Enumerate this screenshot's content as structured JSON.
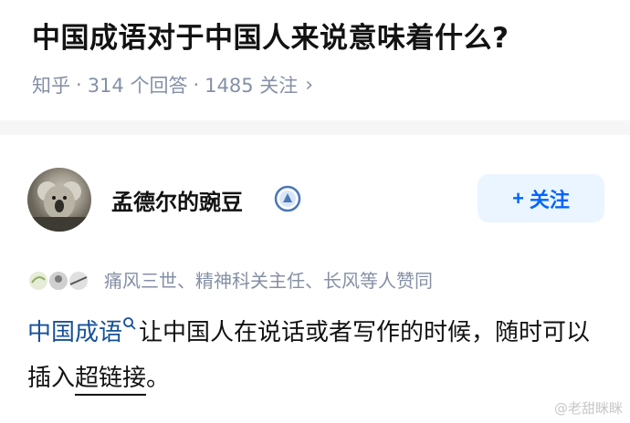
{
  "question": {
    "title": "中国成语对于中国人来说意味着什么?",
    "source": "知乎",
    "answers_count": "314 个回答",
    "followers_count": "1485 关注",
    "sep": "·",
    "chevron": "›"
  },
  "answer": {
    "author_name": "孟德尔的豌豆",
    "badge_icon": "verified-badge-icon",
    "follow_label": "关注",
    "follow_plus": "+",
    "voters_text": "痛风三世、精神科关主任、长风等人赞同",
    "content": {
      "link_text": "中国成语",
      "text_1": "让中国人在说话或者写作的时候，随时可以插入",
      "underlined_text": "超链接",
      "text_2": "。"
    }
  },
  "watermark": "@老甜眯眯",
  "colors": {
    "accent": "#0066ff",
    "follow_bg": "#ebf5ff",
    "meta_gray": "#8590a6",
    "link_blue": "#175199"
  }
}
